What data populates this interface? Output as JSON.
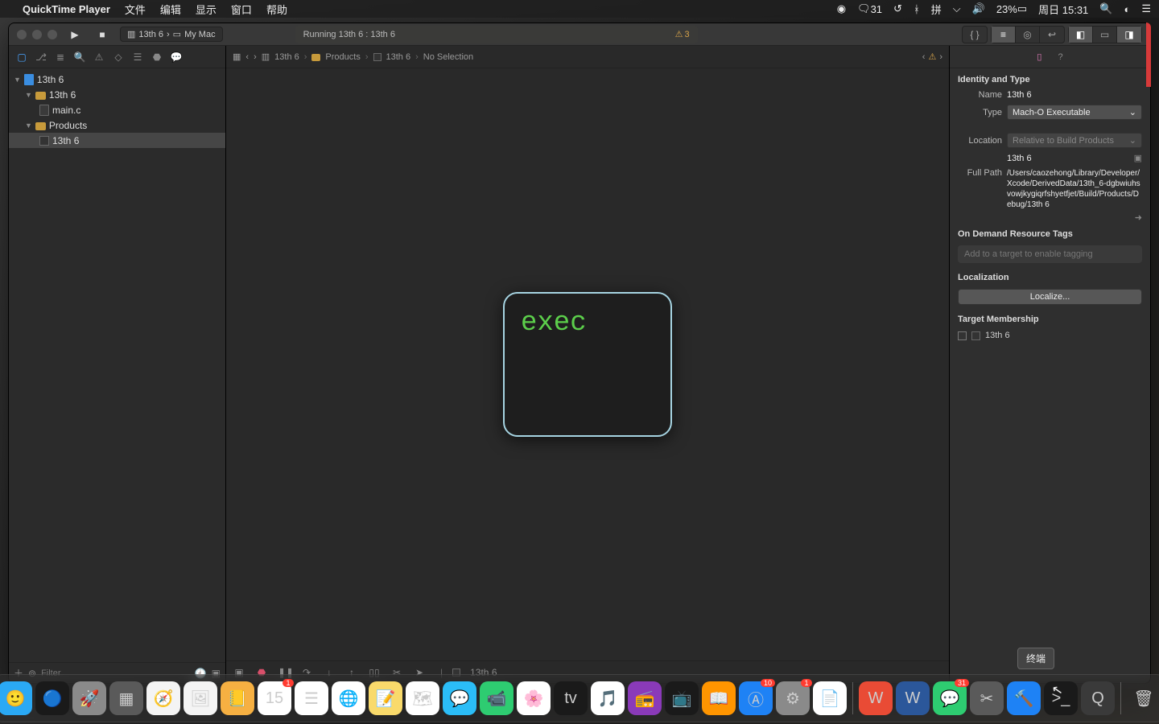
{
  "menubar": {
    "app_name": "QuickTime Player",
    "items": [
      "文件",
      "编辑",
      "显示",
      "窗口",
      "帮助"
    ],
    "right": {
      "wechat_count": "31",
      "battery_pct": "23%",
      "date_time": "周日 15:31"
    }
  },
  "titlebar": {
    "scheme_target": "13th 6",
    "scheme_device": "My Mac",
    "status_text": "Running 13th 6 : 13th 6",
    "warning_count": "3"
  },
  "navigator": {
    "project": "13th 6",
    "group": "13th 6",
    "file1": "main.c",
    "group2": "Products",
    "product": "13th 6",
    "filter_placeholder": "Filter"
  },
  "jump_bar": {
    "p1": "13th 6",
    "p2": "Products",
    "p3": "13th 6",
    "p4": "No Selection"
  },
  "exec_label": "exec",
  "debug_bar": {
    "target": "13th 6"
  },
  "inspector": {
    "identity_h": "Identity and Type",
    "name_lbl": "Name",
    "name_val": "13th 6",
    "type_lbl": "Type",
    "type_val": "Mach-O Executable",
    "loc_lbl": "Location",
    "loc_val": "Relative to Build Products",
    "loc_path": "13th 6",
    "fullpath_lbl": "Full Path",
    "fullpath_val": "/Users/caozehong/Library/Developer/Xcode/DerivedData/13th_6-dgbwiuhsvowjkygiqrfshyetfjet/Build/Products/Debug/13th 6",
    "ondemand_h": "On Demand Resource Tags",
    "ondemand_ph": "Add to a target to enable tagging",
    "local_h": "Localization",
    "local_btn": "Localize...",
    "tm_h": "Target Membership",
    "tm_item": "13th 6"
  },
  "tooltip": "终端",
  "dock": {
    "apps": [
      {
        "name": "finder",
        "bg": "#2aa9f5",
        "glyph": "🙂"
      },
      {
        "name": "siri",
        "bg": "#1a1a1a",
        "glyph": "🔵"
      },
      {
        "name": "launchpad",
        "bg": "#8a8a8a",
        "glyph": "🚀"
      },
      {
        "name": "mission-control",
        "bg": "#5a5a5a",
        "glyph": "▦"
      },
      {
        "name": "safari",
        "bg": "#f4f4f4",
        "glyph": "🧭"
      },
      {
        "name": "preview",
        "bg": "#f4f4f4",
        "glyph": "🖼"
      },
      {
        "name": "books-yellow",
        "bg": "#f6b042",
        "glyph": "📒"
      },
      {
        "name": "calendar",
        "bg": "#fff",
        "glyph": "15",
        "badge": "1"
      },
      {
        "name": "reminders",
        "bg": "#fff",
        "glyph": "☰"
      },
      {
        "name": "chrome",
        "bg": "#fff",
        "glyph": "🌐"
      },
      {
        "name": "notes",
        "bg": "#f9da6b",
        "glyph": "📝"
      },
      {
        "name": "maps",
        "bg": "#fff",
        "glyph": "🗺"
      },
      {
        "name": "messages",
        "bg": "#2bbdf7",
        "glyph": "💬"
      },
      {
        "name": "facetime",
        "bg": "#2ecc71",
        "glyph": "📹"
      },
      {
        "name": "photos",
        "bg": "#fff",
        "glyph": "🌸"
      },
      {
        "name": "appletv",
        "bg": "#1a1a1a",
        "glyph": "tv"
      },
      {
        "name": "music",
        "bg": "#fff",
        "glyph": "🎵"
      },
      {
        "name": "podcasts",
        "bg": "#8a3ab9",
        "glyph": "📻"
      },
      {
        "name": "tv-app",
        "bg": "#1a1a1a",
        "glyph": "📺"
      },
      {
        "name": "ibooks",
        "bg": "#ff9500",
        "glyph": "📖"
      },
      {
        "name": "appstore",
        "bg": "#1e82f5",
        "glyph": "Ⓐ",
        "badge": "10"
      },
      {
        "name": "settings",
        "bg": "#8a8a8a",
        "glyph": "⚙",
        "badge": "1"
      },
      {
        "name": "pages",
        "bg": "#fff",
        "glyph": "📄"
      }
    ],
    "apps2": [
      {
        "name": "wps",
        "bg": "#e94b35",
        "glyph": "W"
      },
      {
        "name": "word",
        "bg": "#2b579a",
        "glyph": "W"
      },
      {
        "name": "wechat",
        "bg": "#2ecc71",
        "glyph": "💬",
        "badge": "31"
      },
      {
        "name": "screenshot",
        "bg": "#5a5a5a",
        "glyph": "✂"
      },
      {
        "name": "xcode",
        "bg": "#1e82f5",
        "glyph": "🔨"
      },
      {
        "name": "terminal",
        "bg": "#1a1a1a",
        "glyph": ">_"
      },
      {
        "name": "quicktime",
        "bg": "#3a3a3a",
        "glyph": "Q"
      }
    ],
    "trash": {
      "name": "trash",
      "bg": "transparent",
      "glyph": "🗑"
    }
  }
}
